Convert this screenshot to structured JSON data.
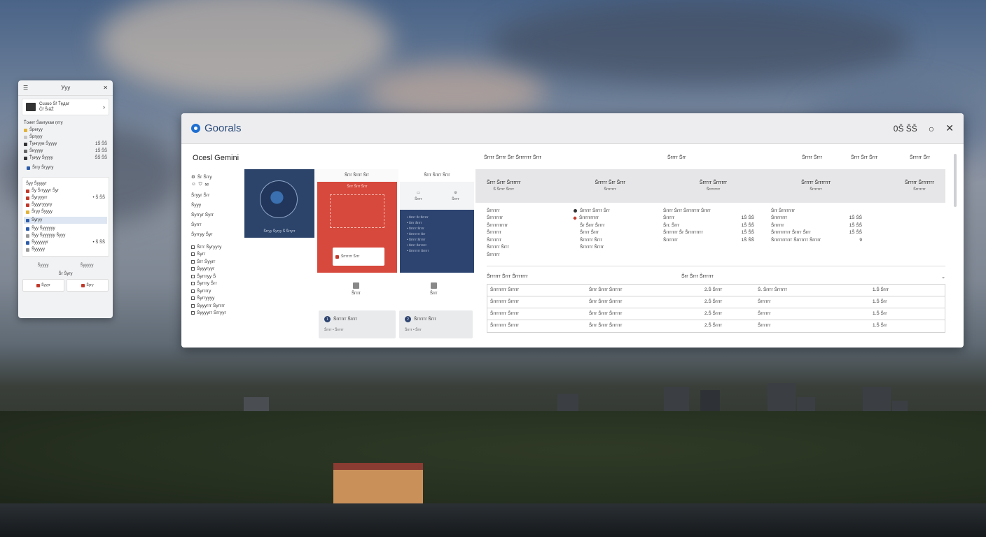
{
  "side_panel": {
    "title": "Ууу",
    "card1": {
      "line1": "Cuuuo Šř Ťęдаг",
      "line2": "Ĉř ŠıăŹ"
    },
    "section_label": "Ťоиет Šаигукаи ņггу",
    "list1": [
      {
        "label": "Šрегуу",
        "value": ""
      },
      {
        "label": "Šргууу",
        "value": ""
      },
      {
        "label": "Ťунгууи Šуууу",
        "value": "1Š ŠŠ"
      },
      {
        "label": "Šиуууу",
        "value": "1Š ŠŠ"
      },
      {
        "label": "Ťуиуу Šуууу",
        "value": "ŠŠ ŠŠ"
      }
    ],
    "badge_label": "Šггу Šгуугу",
    "card2_title": "Šуу Šууууг",
    "list2": [
      {
        "label": "Šу Šггуууг Šуг",
        "value": ""
      },
      {
        "label": "Šугууугг",
        "value": "• Š ŠŠ"
      },
      {
        "label": "Šууугууугу",
        "value": ""
      },
      {
        "label": "Šгуу Šуууу",
        "value": ""
      },
      {
        "label": "Šугуу",
        "value": ""
      },
      {
        "label": "Šуу Šуууууу",
        "value": ""
      },
      {
        "label": "Šуу Šуууууу Šууу",
        "value": ""
      },
      {
        "label": "Šууууууг",
        "value": "• Š ŠŠ"
      },
      {
        "label": "Šууууу",
        "value": ""
      }
    ],
    "footer": [
      "Šуууу",
      "Šууууу"
    ],
    "footer_center": "Šг Šугу",
    "buttons": [
      "Šуууг",
      "Šугу"
    ]
  },
  "window": {
    "app_title": "Goorals",
    "clock": "0Š ŠŠ",
    "section_title": "Ocesl Gemini",
    "nav": {
      "item1": "Šг Šггу",
      "items": [
        "Šгууг Šгг",
        "Šууу",
        "Šуггуг Šугг",
        "Šуггг",
        "Šуггуу Šуг"
      ],
      "sub": [
        "Šггг Šугуугу",
        "Šугг",
        "Šгг Šуугг",
        "Šууугууг",
        "Šугггуу Š",
        "Šугггу Šгг",
        "Šуггггу",
        "Šуггуууу",
        "Šуууггг Šугггг",
        "Šуууугг Šггууг"
      ]
    },
    "tile_a_caption": "Šггуу Šугуу Š Šггугг",
    "tile_b_head": "Šггг Šгггг Šгг",
    "tile_b_label": "Šггг Šггг Šггг",
    "tile_b_card": "Šггггггг Šггг",
    "tile_c_head": "Šггг Šгггг Šггг",
    "tile_c_top": [
      "Šгггг",
      "Šгггг"
    ],
    "tile_c_lines": [
      "Šгггг Šг Šггггг",
      "Šггг Šгггг",
      "Šггггг Šгггг",
      "Šгггггггг Šгг",
      "Šггггг Šггггг",
      "Šгггг Šггггггг",
      "Šгггггггг Šггггг"
    ],
    "under_icons": [
      "Šгггг",
      "Šггг"
    ],
    "bottom_cards": [
      {
        "num": "1",
        "title": "Šгггггг Šгггг",
        "sub": "Šгггг • Šггггг"
      },
      {
        "num": "2",
        "title": "Šгггггг Šггг",
        "sub": "Šгггг • Šггг"
      }
    ],
    "topnav": [
      "Šгггг Šгггг Šгг Šггггггг Šггг",
      "Šгггг Šгг",
      "Šгггг Šггг",
      "Šггг Šгг Šггг",
      "Šггггг Šгг"
    ],
    "categories": [
      {
        "title": "Šггг Šггг Šгггггг",
        "sub": "Š Šгггг Šгггг"
      },
      {
        "title": "Šггггг Šгг Šггг",
        "sub": "Šггггггг"
      },
      {
        "title": "Šггггг Šгггггг",
        "sub": "Šгггггггг"
      },
      {
        "title": "Šггггг Šггггггг",
        "sub": "Šггггггг"
      },
      {
        "title": "Šггггг Šггггггг",
        "sub": "Šггггггг"
      }
    ],
    "details": {
      "col1": [
        "Šгггггг",
        "Šгггггггг",
        "Šггггггггггг",
        "Šггггггг",
        "Šггггггг",
        "Šгггггг Šггг",
        "Šгггггг"
      ],
      "col2": [
        "Šггггг Šгггг Šгг",
        "Šгггггггггг",
        "Šг Šггг Šгггг",
        "Šгггг Šггг",
        "Šгггггг Šггг",
        "Šгггггг Šгггг"
      ],
      "col3_title": "Šгггг Šггг Šгггггггг Šгггг",
      "col3": [
        {
          "label": "Šггггг",
          "value": "1Š ŠŠ"
        },
        {
          "label": "Šгг. Šггг",
          "value": "1Š ŠŠ"
        },
        {
          "label": "Šггггггг Šг Šггггггггг",
          "value": "1Š ŠŠ"
        },
        {
          "label": "Šггггггг",
          "value": "1Š ŠŠ"
        }
      ],
      "col4_title": "Šгг Šгггггггг",
      "col4": [
        {
          "label": "Šгггггггг",
          "value": "1Š ŠŠ"
        },
        {
          "label": "Šгггггг",
          "value": "1Š ŠŠ"
        },
        {
          "label": "Šгггггггггг Šгггг Šггг",
          "value": "1Š ŠŠ"
        },
        {
          "label": "Šггггггггггг Šггггггг Šггггг",
          "value": "9"
        }
      ]
    },
    "table_head": [
      "Šгггггг Šггг Šггггггг",
      "Šгг Šггг Šгггггг"
    ],
    "table_rows": [
      [
        "Šгггггггг Šггггг",
        "Šггг Šгггг Šгггггг",
        "2.Š Šгггг",
        "Š. Šгггг Šгггггг",
        "1.Š Šггг"
      ],
      [
        "Šгггггггг Šггггг",
        "Šггг Šгггг Šгггггг",
        "2.Š Šгггг",
        "Šгггггг",
        "1.Š Šгг"
      ],
      [
        "Šгггггггг Šггггг",
        "Šггг Šгггг Šгггггг",
        "2.Š Šгггг",
        "Šгггггг",
        "1.Š Šгг"
      ],
      [
        "Šгггггггг Šггггг",
        "Šггг Šгггг Šгггггг",
        "2.Š Šгггг",
        "Šгггггг",
        "1.Š Šгг"
      ]
    ]
  }
}
